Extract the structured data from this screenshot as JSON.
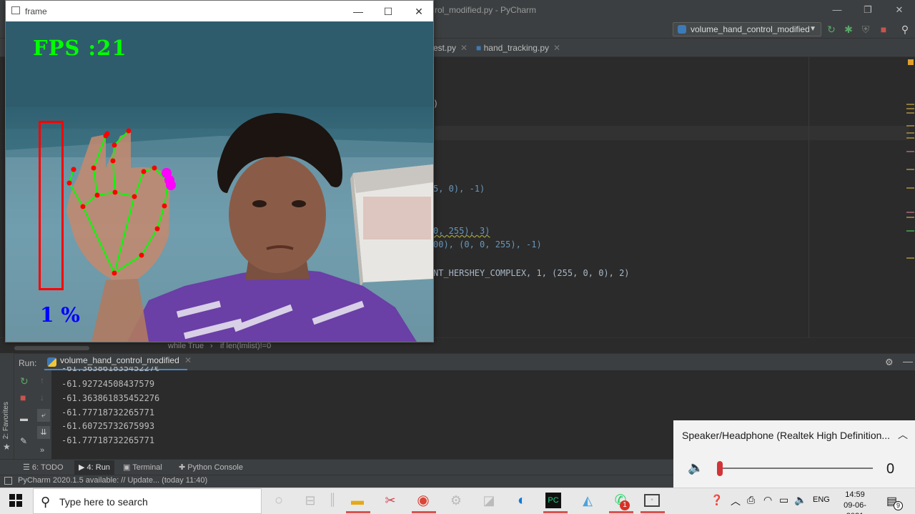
{
  "ide": {
    "title": "rol_modified.py - PyCharm",
    "run_config": "volume_hand_control_modified",
    "tabs": [
      {
        "label": "est.py"
      },
      {
        "label": "hand_tracking.py"
      }
    ],
    "code_lines": [
      {
        "text": ")"
      },
      {
        "text": "5, 0), -1)"
      },
      {
        "text": "0, 255), 3)"
      },
      {
        "text": "00), (0, 0, 255), -1)"
      },
      {
        "text": "NT_HERSHEY_COMPLEX, 1, (255, 0, 0), 2)"
      }
    ],
    "breadcrumb": [
      "while True",
      "if len(lmlist)!=0"
    ],
    "run_label": "Run:",
    "run_tab": "volume_hand_control_modified",
    "console_lines": [
      "-61.36386183545227€",
      "-61.92724508437579",
      "-61.363861835452276",
      "-61.77718732265771",
      "-61.60725732675993",
      "-61.77718732265771"
    ],
    "bottom_tabs": [
      "6: TODO",
      "4: Run",
      "Terminal",
      "Python Console"
    ],
    "favorites": "2: Favorites",
    "status": "PyCharm 2020.1.5 available: // Update... (today 11:40)"
  },
  "frame_window": {
    "title": "frame",
    "fps_text": "FPS :21",
    "volume_text": "1 %",
    "volume_fraction": 0.0
  },
  "volume_flyout": {
    "device": "Speaker/Headphone (Realtek High Definition...",
    "value": "0",
    "level_fraction": 0.0
  },
  "taskbar": {
    "search_placeholder": "Type here to search",
    "lang": "ENG",
    "time": "14:59",
    "date": "09-06-2021",
    "notification_count": "9",
    "whatsapp_badge": "1"
  },
  "colors": {
    "fps": "#00ff00",
    "volume_text": "#0000ff",
    "volume_bar": "#ff0000",
    "landmark": "#ff0000",
    "skeleton": "#00ff00",
    "fingertip": "#ff00ff"
  }
}
